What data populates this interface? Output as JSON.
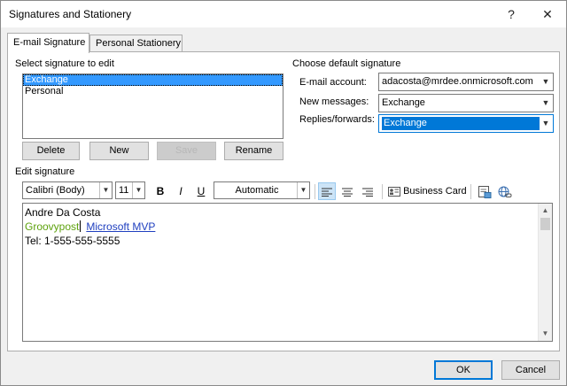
{
  "window": {
    "title": "Signatures and Stationery",
    "help_button": "?",
    "close_button": "✕"
  },
  "tabs": [
    {
      "label": "E-mail Signature",
      "active": true
    },
    {
      "label": "Personal Stationery",
      "active": false
    }
  ],
  "select_section": {
    "label": "Select signature to edit",
    "items": [
      "Exchange",
      "Personal"
    ],
    "selected": "Exchange"
  },
  "signature_buttons": {
    "delete": "Delete",
    "new": "New",
    "save": "Save",
    "rename": "Rename"
  },
  "default_section": {
    "label": "Choose default signature",
    "email_account_label": "E-mail account:",
    "email_account_value": "adacosta@mrdee.onmicrosoft.com",
    "new_messages_label": "New messages:",
    "new_messages_value": "Exchange",
    "replies_label": "Replies/forwards:",
    "replies_value": "Exchange"
  },
  "edit_section": {
    "label": "Edit signature",
    "font_name": "Calibri (Body)",
    "font_size": "11",
    "bold": "B",
    "italic": "I",
    "underline": "U",
    "color": "Automatic",
    "business_card": "Business Card"
  },
  "signature_content": {
    "line1": "Andre Da Costa",
    "line2_green": "Groovypost",
    "line2_link": "Microsoft MVP",
    "line3": "Tel: 1-555-555-5555",
    "green_color": "#5ea20e",
    "link_color": "#1f3fbf"
  },
  "footer": {
    "ok": "OK",
    "cancel": "Cancel"
  }
}
